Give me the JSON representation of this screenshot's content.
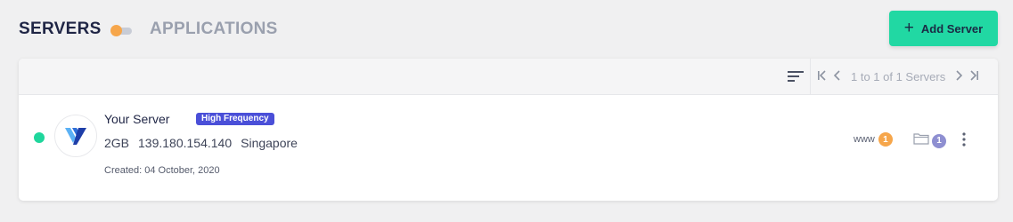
{
  "header": {
    "servers_label": "SERVERS",
    "applications_label": "APPLICATIONS",
    "add_button_label": "Add Server",
    "add_button_icon": "plus-icon"
  },
  "toolbar": {
    "sort_icon": "sort-lines-icon",
    "pagination_text": "1 to 1 of 1 Servers",
    "first_icon": "first-page-icon",
    "prev_icon": "chevron-left-icon",
    "next_icon": "chevron-right-icon",
    "last_icon": "last-page-icon"
  },
  "server": {
    "status": "running",
    "provider_icon": "vultr-logo-icon",
    "name": "Your Server",
    "badge": "High Frequency",
    "size": "2GB",
    "ip": "139.180.154.140",
    "location": "Singapore",
    "created": "Created: 04 October, 2020",
    "www_label": "www",
    "www_count": "1",
    "folder_count": "1"
  },
  "colors": {
    "accent": "#21d8a3",
    "status_dot": "#1fd69c",
    "badge": "#4a4fd8",
    "orange": "#f6a64b",
    "purple_count": "#8e8fd1",
    "title": "#1f2545"
  }
}
